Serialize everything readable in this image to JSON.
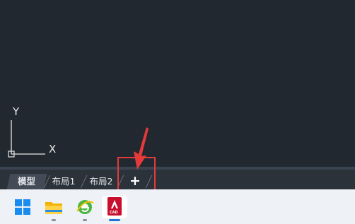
{
  "canvas": {
    "ucs_y_label": "Y",
    "ucs_x_label": "X"
  },
  "layout_tabs": [
    {
      "label": "模型",
      "active": true
    },
    {
      "label": "布局1",
      "active": false
    },
    {
      "label": "布局2",
      "active": false
    }
  ],
  "add_tab_label": "+",
  "taskbar": {
    "apps": [
      {
        "icon": "windows-start-icon"
      },
      {
        "icon": "file-explorer-icon",
        "running": true
      },
      {
        "icon": "browser-icon",
        "running": true
      },
      {
        "icon": "autocad-icon",
        "badge": "CAD",
        "running": true,
        "active": true
      }
    ]
  },
  "colors": {
    "canvas_bg": "#212830",
    "tab_bar_bg": "#2c323a",
    "active_tab_bg": "#434b56",
    "annotation_red": "#e53a3a",
    "taskbar_bg": "#eef1f6",
    "active_indicator": "#1f72d6"
  }
}
